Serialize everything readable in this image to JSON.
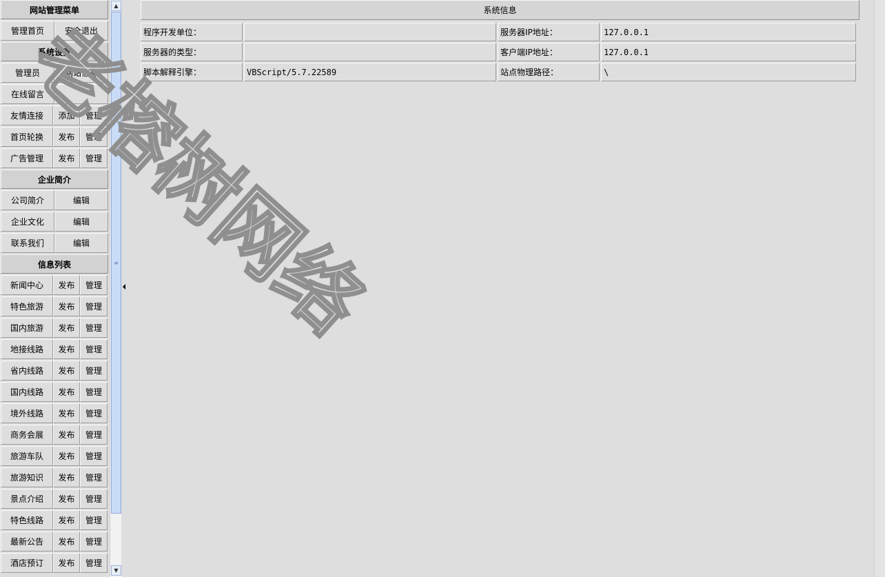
{
  "menu": {
    "title": "网站管理菜单",
    "top_links": [
      "管理首页",
      "安全退出"
    ],
    "system": {
      "title": "系统设置",
      "row1": [
        "管理员",
        "网站信息"
      ],
      "row2": "在线留言",
      "rows": [
        {
          "label": "友情连接",
          "a": "添加",
          "b": "管理"
        },
        {
          "label": "首页轮换",
          "a": "发布",
          "b": "管理"
        },
        {
          "label": "广告管理",
          "a": "发布",
          "b": "管理"
        }
      ]
    },
    "company": {
      "title": "企业简介",
      "rows": [
        {
          "label": "公司简介",
          "action": "编辑"
        },
        {
          "label": "企业文化",
          "action": "编辑"
        },
        {
          "label": "联系我们",
          "action": "编辑"
        }
      ]
    },
    "info": {
      "title": "信息列表",
      "rows": [
        {
          "label": "新闻中心",
          "a": "发布",
          "b": "管理"
        },
        {
          "label": "特色旅游",
          "a": "发布",
          "b": "管理"
        },
        {
          "label": "国内旅游",
          "a": "发布",
          "b": "管理"
        },
        {
          "label": "地接线路",
          "a": "发布",
          "b": "管理"
        },
        {
          "label": "省内线路",
          "a": "发布",
          "b": "管理"
        },
        {
          "label": "国内线路",
          "a": "发布",
          "b": "管理"
        },
        {
          "label": "境外线路",
          "a": "发布",
          "b": "管理"
        },
        {
          "label": "商务会展",
          "a": "发布",
          "b": "管理"
        },
        {
          "label": "旅游车队",
          "a": "发布",
          "b": "管理"
        },
        {
          "label": "旅游知识",
          "a": "发布",
          "b": "管理"
        },
        {
          "label": "景点介绍",
          "a": "发布",
          "b": "管理"
        },
        {
          "label": "特色线路",
          "a": "发布",
          "b": "管理"
        },
        {
          "label": "最新公告",
          "a": "发布",
          "b": "管理"
        },
        {
          "label": "酒店预订",
          "a": "发布",
          "b": "管理"
        }
      ]
    }
  },
  "sysinfo": {
    "title": "系统信息",
    "rows": [
      {
        "k1": "程序开发单位：",
        "v1": "",
        "k2": "服务器IP地址：",
        "v2": "127.0.0.1"
      },
      {
        "k1": "服务器的类型：",
        "v1": "",
        "k2": "客户端IP地址：",
        "v2": "127.0.0.1"
      },
      {
        "k1": "脚本解释引擎：",
        "v1": "VBScript/5.7.22589",
        "k2": "站点物理路径：",
        "v2": "\\"
      }
    ]
  },
  "watermark": "老榕树网络",
  "icons": {
    "scroll_up": "chevron-up-icon",
    "scroll_down": "chevron-down-icon",
    "collapse": "triangle-left-icon"
  }
}
